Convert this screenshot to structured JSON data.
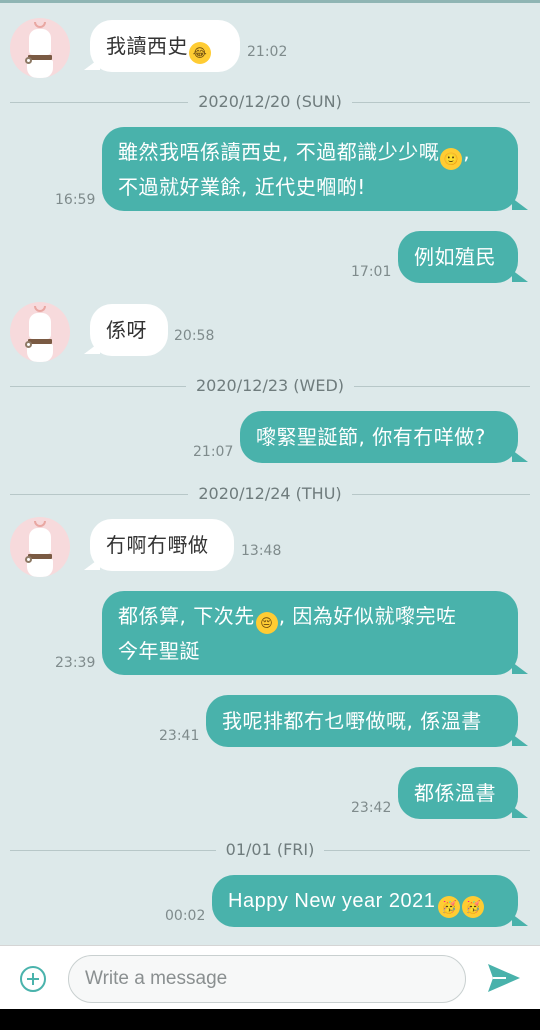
{
  "colors": {
    "accent": "#49b2ab",
    "background": "#dde9ea",
    "incoming_bubble": "#ffffff"
  },
  "messages": [
    {
      "dir": "in",
      "text": "我讀西史",
      "emoji": "laughing-emoji",
      "emoji_glyph": "😂",
      "time": "21:02"
    },
    {
      "date": "2020/12/20 (SUN)"
    },
    {
      "dir": "out",
      "line1": "雖然我唔係讀西史, 不過都識少少嘅",
      "emoji": "smiling-emoji",
      "emoji_glyph": "🙂",
      "line1_end": ",",
      "line2": "不過就好業餘, 近代史嗰啲!",
      "time": "16:59"
    },
    {
      "dir": "out",
      "text": "例如殖民",
      "time": "17:01"
    },
    {
      "dir": "in",
      "text": "係呀",
      "time": "20:58"
    },
    {
      "date": "2020/12/23 (WED)"
    },
    {
      "dir": "out",
      "text": "嚟緊聖誕節, 你有冇咩做?",
      "time": "21:07"
    },
    {
      "date": "2020/12/24 (THU)"
    },
    {
      "dir": "in",
      "text": "冇啊冇嘢做",
      "time": "13:48"
    },
    {
      "dir": "out",
      "line1a": "都係算, 下次先",
      "emoji": "pensive-emoji",
      "emoji_glyph": "😔",
      "line1b": ", 因為好似就嚟完咗",
      "line2": "今年聖誕",
      "time": "23:39"
    },
    {
      "dir": "out",
      "text": "我呢排都冇乜嘢做嘅, 係溫書",
      "time": "23:41"
    },
    {
      "dir": "out",
      "text": "都係溫書",
      "time": "23:42"
    },
    {
      "date": "01/01 (FRI)"
    },
    {
      "dir": "out",
      "text": "Happy New year 2021",
      "emoji": "party-face-emoji",
      "emoji_glyph": "🥳",
      "time": "00:02"
    }
  ],
  "composer": {
    "placeholder": "Write a message"
  }
}
